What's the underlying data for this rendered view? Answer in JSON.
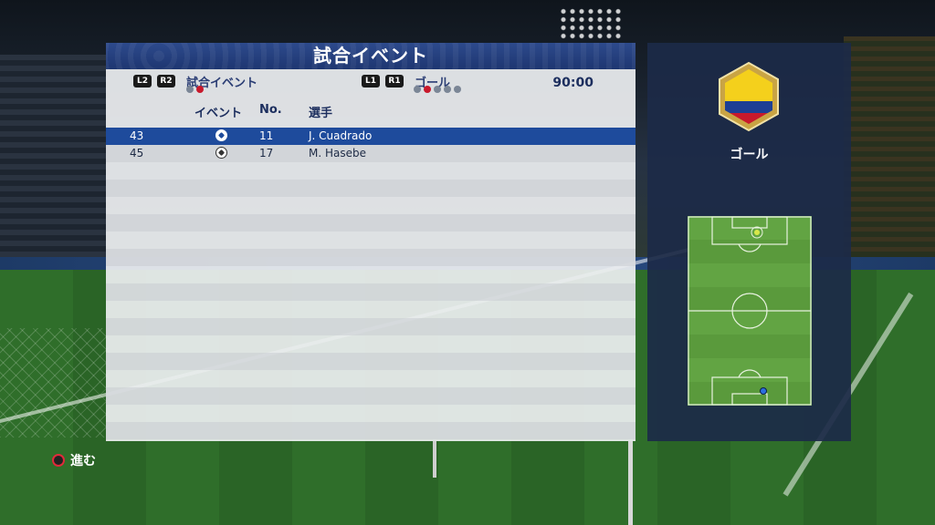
{
  "header": {
    "title": "試合イベント"
  },
  "controls": {
    "left": {
      "buttons": [
        "L2",
        "R2"
      ],
      "label": "試合イベント",
      "dots_total": 2,
      "dots_active": 2
    },
    "right": {
      "buttons": [
        "L1",
        "R1"
      ],
      "label": "ゴール",
      "dots_total": 5,
      "dots_active": 2
    },
    "time": "90:00"
  },
  "columns": {
    "event": "イベント",
    "number": "No.",
    "player": "選手"
  },
  "events": [
    {
      "minute": "43",
      "icon": "goal-ball-icon",
      "number": "11",
      "player": "J. Cuadrado",
      "selected": true
    },
    {
      "minute": "45",
      "icon": "goal-ball-icon",
      "number": "17",
      "player": "M. Hasebe",
      "selected": false
    }
  ],
  "side": {
    "crest_icon": "colombia-flag-crest-icon",
    "event_label": "ゴール",
    "colors": {
      "yellow": "#f4d01c",
      "blue": "#1d3f94",
      "red": "#c8192c",
      "gold": "#c9a444"
    }
  },
  "footer": {
    "hint_icon": "circle-button-icon",
    "hint_label": "進む"
  },
  "colors": {
    "header": "#24407f",
    "selected_row": "#1e4b9c",
    "pitch": "#5a9a3c"
  }
}
